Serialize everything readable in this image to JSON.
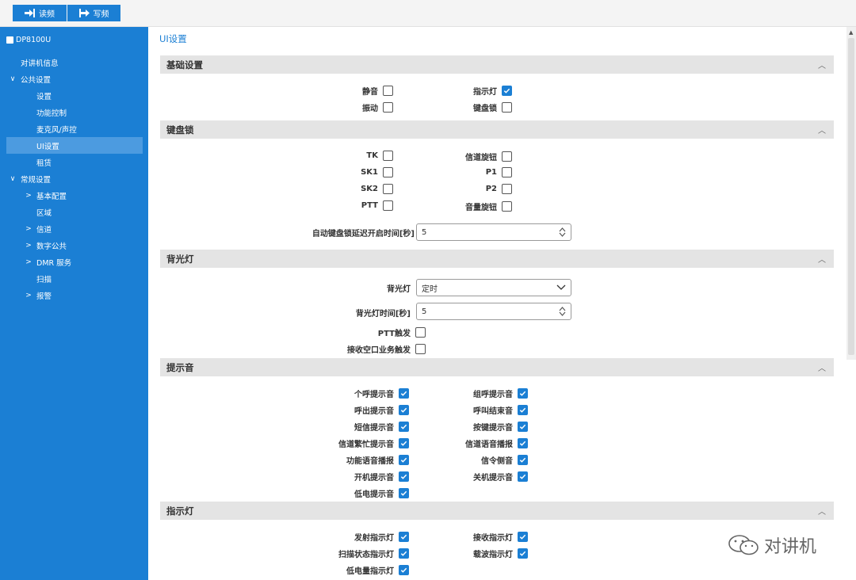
{
  "toolbar": {
    "read_label": "读频",
    "write_label": "写频"
  },
  "sidebar": {
    "root": "DP8100U",
    "items": [
      {
        "label": "对讲机信息",
        "level": 1,
        "chevron": ""
      },
      {
        "label": "公共设置",
        "level": 1,
        "chevron": "∨"
      },
      {
        "label": "设置",
        "level": 2,
        "chevron": ""
      },
      {
        "label": "功能控制",
        "level": 2,
        "chevron": ""
      },
      {
        "label": "麦克风/声控",
        "level": 2,
        "chevron": ""
      },
      {
        "label": "UI设置",
        "level": 2,
        "chevron": "",
        "active": true
      },
      {
        "label": "租赁",
        "level": 2,
        "chevron": ""
      },
      {
        "label": "常规设置",
        "level": 1,
        "chevron": "∨"
      },
      {
        "label": "基本配置",
        "level": 2,
        "chevron": ">"
      },
      {
        "label": "区域",
        "level": 2,
        "chevron": ""
      },
      {
        "label": "信道",
        "level": 2,
        "chevron": ">"
      },
      {
        "label": "数字公共",
        "level": 2,
        "chevron": ">"
      },
      {
        "label": "DMR 服务",
        "level": 2,
        "chevron": ">"
      },
      {
        "label": "扫描",
        "level": 2,
        "chevron": ""
      },
      {
        "label": "报警",
        "level": 2,
        "chevron": ">"
      }
    ]
  },
  "page_title": "UI设置",
  "sections": {
    "basic": {
      "title": "基础设置"
    },
    "keylock": {
      "title": "键盘锁"
    },
    "backlight": {
      "title": "背光灯"
    },
    "tones": {
      "title": "提示音"
    },
    "indicator": {
      "title": "指示灯"
    }
  },
  "basic": {
    "mute": {
      "label": "静音",
      "checked": false
    },
    "vibrate": {
      "label": "振动",
      "checked": false
    },
    "indicator_light": {
      "label": "指示灯",
      "checked": true
    },
    "keypad_lock": {
      "label": "键盘锁",
      "checked": false
    }
  },
  "keylock": {
    "tk": {
      "label": "TK",
      "checked": false
    },
    "sk1": {
      "label": "SK1",
      "checked": false
    },
    "sk2": {
      "label": "SK2",
      "checked": false
    },
    "ptt": {
      "label": "PTT",
      "checked": false
    },
    "channel_knob": {
      "label": "信道旋钮",
      "checked": false
    },
    "p1": {
      "label": "P1",
      "checked": false
    },
    "p2": {
      "label": "P2",
      "checked": false
    },
    "volume_knob": {
      "label": "音量旋钮",
      "checked": false
    },
    "auto_delay_label": "自动键盘锁延迟开启时间[秒]",
    "auto_delay_value": "5"
  },
  "backlight": {
    "mode_label": "背光灯",
    "mode_value": "定时",
    "time_label": "背光灯时间[秒]",
    "time_value": "5",
    "ptt_trigger": {
      "label": "PTT触发",
      "checked": false
    },
    "rx_trigger": {
      "label": "接收空口业务触发",
      "checked": false
    }
  },
  "tones": {
    "left": [
      {
        "label": "个呼提示音",
        "checked": true
      },
      {
        "label": "呼出提示音",
        "checked": true
      },
      {
        "label": "短信提示音",
        "checked": true
      },
      {
        "label": "信道繁忙提示音",
        "checked": true
      },
      {
        "label": "功能语音播报",
        "checked": true
      },
      {
        "label": "开机提示音",
        "checked": true
      },
      {
        "label": "低电提示音",
        "checked": true
      }
    ],
    "right": [
      {
        "label": "组呼提示音",
        "checked": true
      },
      {
        "label": "呼叫结束音",
        "checked": true
      },
      {
        "label": "按键提示音",
        "checked": true
      },
      {
        "label": "信道语音播报",
        "checked": true
      },
      {
        "label": "信令侧音",
        "checked": true
      },
      {
        "label": "关机提示音",
        "checked": true
      }
    ]
  },
  "indicator": {
    "left": [
      {
        "label": "发射指示灯",
        "checked": true
      },
      {
        "label": "扫描状态指示灯",
        "checked": true
      },
      {
        "label": "低电量指示灯",
        "checked": true
      }
    ],
    "right": [
      {
        "label": "接收指示灯",
        "checked": true
      },
      {
        "label": "载波指示灯",
        "checked": true
      }
    ]
  },
  "watermark": "对讲机",
  "colors": {
    "accent": "#1b7fd4",
    "section_bg": "#e4e4e4",
    "active_item": "#4c9be0"
  }
}
